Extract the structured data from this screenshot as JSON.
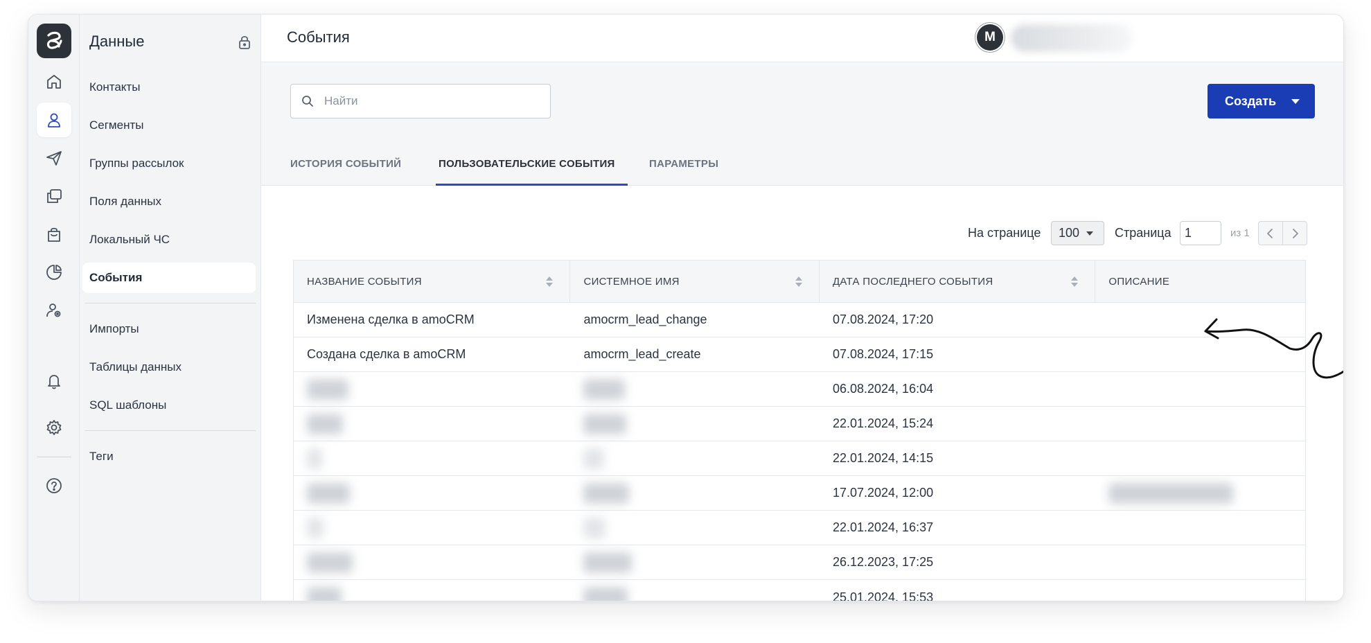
{
  "rail": {
    "items": [
      {
        "icon": "home-icon"
      },
      {
        "icon": "user-icon",
        "active": true
      },
      {
        "icon": "send-icon"
      },
      {
        "icon": "copy-icon"
      },
      {
        "icon": "shopping-bag-icon"
      },
      {
        "icon": "pie-chart-icon"
      },
      {
        "icon": "user-settings-icon"
      },
      {
        "icon": "bell-icon"
      },
      {
        "icon": "gear-icon"
      },
      {
        "icon": "help-icon"
      }
    ]
  },
  "subnav": {
    "title": "Данные",
    "items": [
      "Контакты",
      "Сегменты",
      "Группы рассылок",
      "Поля данных",
      "Локальный ЧС",
      "События",
      "Импорты",
      "Таблицы данных",
      "SQL шаблоны",
      "Теги"
    ],
    "active": "События"
  },
  "header": {
    "title": "События",
    "avatar_letter": "M"
  },
  "toolbar": {
    "search_placeholder": "Найти",
    "create_label": "Создать"
  },
  "tabs": [
    {
      "label": "ИСТОРИЯ СОБЫТИЙ"
    },
    {
      "label": "ПОЛЬЗОВАТЕЛЬСКИЕ СОБЫТИЯ",
      "active": true
    },
    {
      "label": "ПАРАМЕТРЫ"
    }
  ],
  "pagination": {
    "per_page_label": "На странице",
    "per_page_value": "100",
    "page_label": "Страница",
    "page_value": "1",
    "of_label": "из 1"
  },
  "table": {
    "columns": [
      "НАЗВАНИЕ СОБЫТИЯ",
      "СИСТЕМНОЕ ИМЯ",
      "ДАТА ПОСЛЕДНЕГО СОБЫТИЯ",
      "ОПИСАНИЕ"
    ],
    "rows": [
      {
        "name": "Изменена сделка в amoCRM",
        "system": "amocrm_lead_change",
        "date": "07.08.2024, 17:20",
        "desc": ""
      },
      {
        "name": "Создана сделка в amoCRM",
        "system": "amocrm_lead_create",
        "date": "07.08.2024, 17:15",
        "desc": ""
      },
      {
        "name": "",
        "system": "",
        "date": "06.08.2024, 16:04",
        "desc": ""
      },
      {
        "name": "",
        "system": "",
        "date": "22.01.2024, 15:24",
        "desc": ""
      },
      {
        "name": "",
        "system": "",
        "date": "22.01.2024, 14:15",
        "desc": ""
      },
      {
        "name": "",
        "system": "",
        "date": "17.07.2024, 12:00",
        "desc": ""
      },
      {
        "name": "",
        "system": "",
        "date": "22.01.2024, 16:37",
        "desc": ""
      },
      {
        "name": "",
        "system": "",
        "date": "26.12.2023, 17:25",
        "desc": ""
      },
      {
        "name": "",
        "system": "",
        "date": "25.01.2024, 15:53",
        "desc": ""
      }
    ]
  },
  "colors": {
    "accent": "#1a3db5",
    "tab_underline": "#2a4bc4",
    "sidebar_bg": "#f2f4f6",
    "icon_active": "#2a4bc4",
    "icon_default": "#4a525c"
  }
}
